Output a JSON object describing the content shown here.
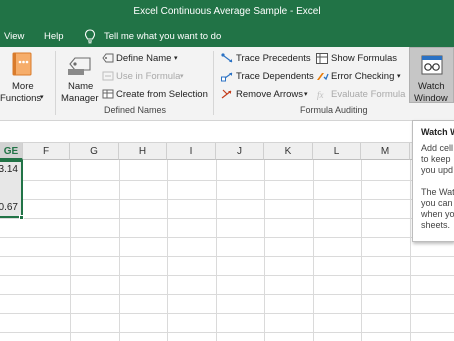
{
  "window": {
    "title": "Excel Continuous Average Sample  -  Excel"
  },
  "menu": {
    "view": "View",
    "help": "Help",
    "tell_me": "Tell me what you want to do"
  },
  "ribbon": {
    "more_functions": {
      "line1": "More",
      "line2": "Functions",
      "caret": "▾"
    },
    "name_manager": {
      "line1": "Name",
      "line2": "Manager"
    },
    "define_name": "Define Name",
    "use_in_formula": "Use in Formula",
    "create_from_selection": "Create from Selection",
    "defined_names_label": "Defined Names",
    "trace_precedents": "Trace Precedents",
    "trace_dependents": "Trace Dependents",
    "remove_arrows": "Remove Arrows",
    "show_formulas": "Show Formulas",
    "error_checking": "Error Checking",
    "evaluate_formula": "Evaluate Formula",
    "formula_auditing_label": "Formula Auditing",
    "watch_window": {
      "line1": "Watch",
      "line2": "Window"
    },
    "caret": "▾"
  },
  "tooltip": {
    "title": "Watch W",
    "lines": [
      "Add cell",
      "to keep",
      "you upd",
      "The Wat",
      "you can",
      "when you",
      "sheets."
    ]
  },
  "grid": {
    "columns": [
      "GE",
      "F",
      "G",
      "H",
      "I",
      "J",
      "K",
      "L",
      "M"
    ],
    "values": [
      "3.14",
      "0.67"
    ]
  },
  "colors": {
    "brand_green": "#217346",
    "ribbon_bg": "#f3f3f3",
    "error_icon": "#e87d0d",
    "remove_arrows_red": "#c43e1c"
  }
}
